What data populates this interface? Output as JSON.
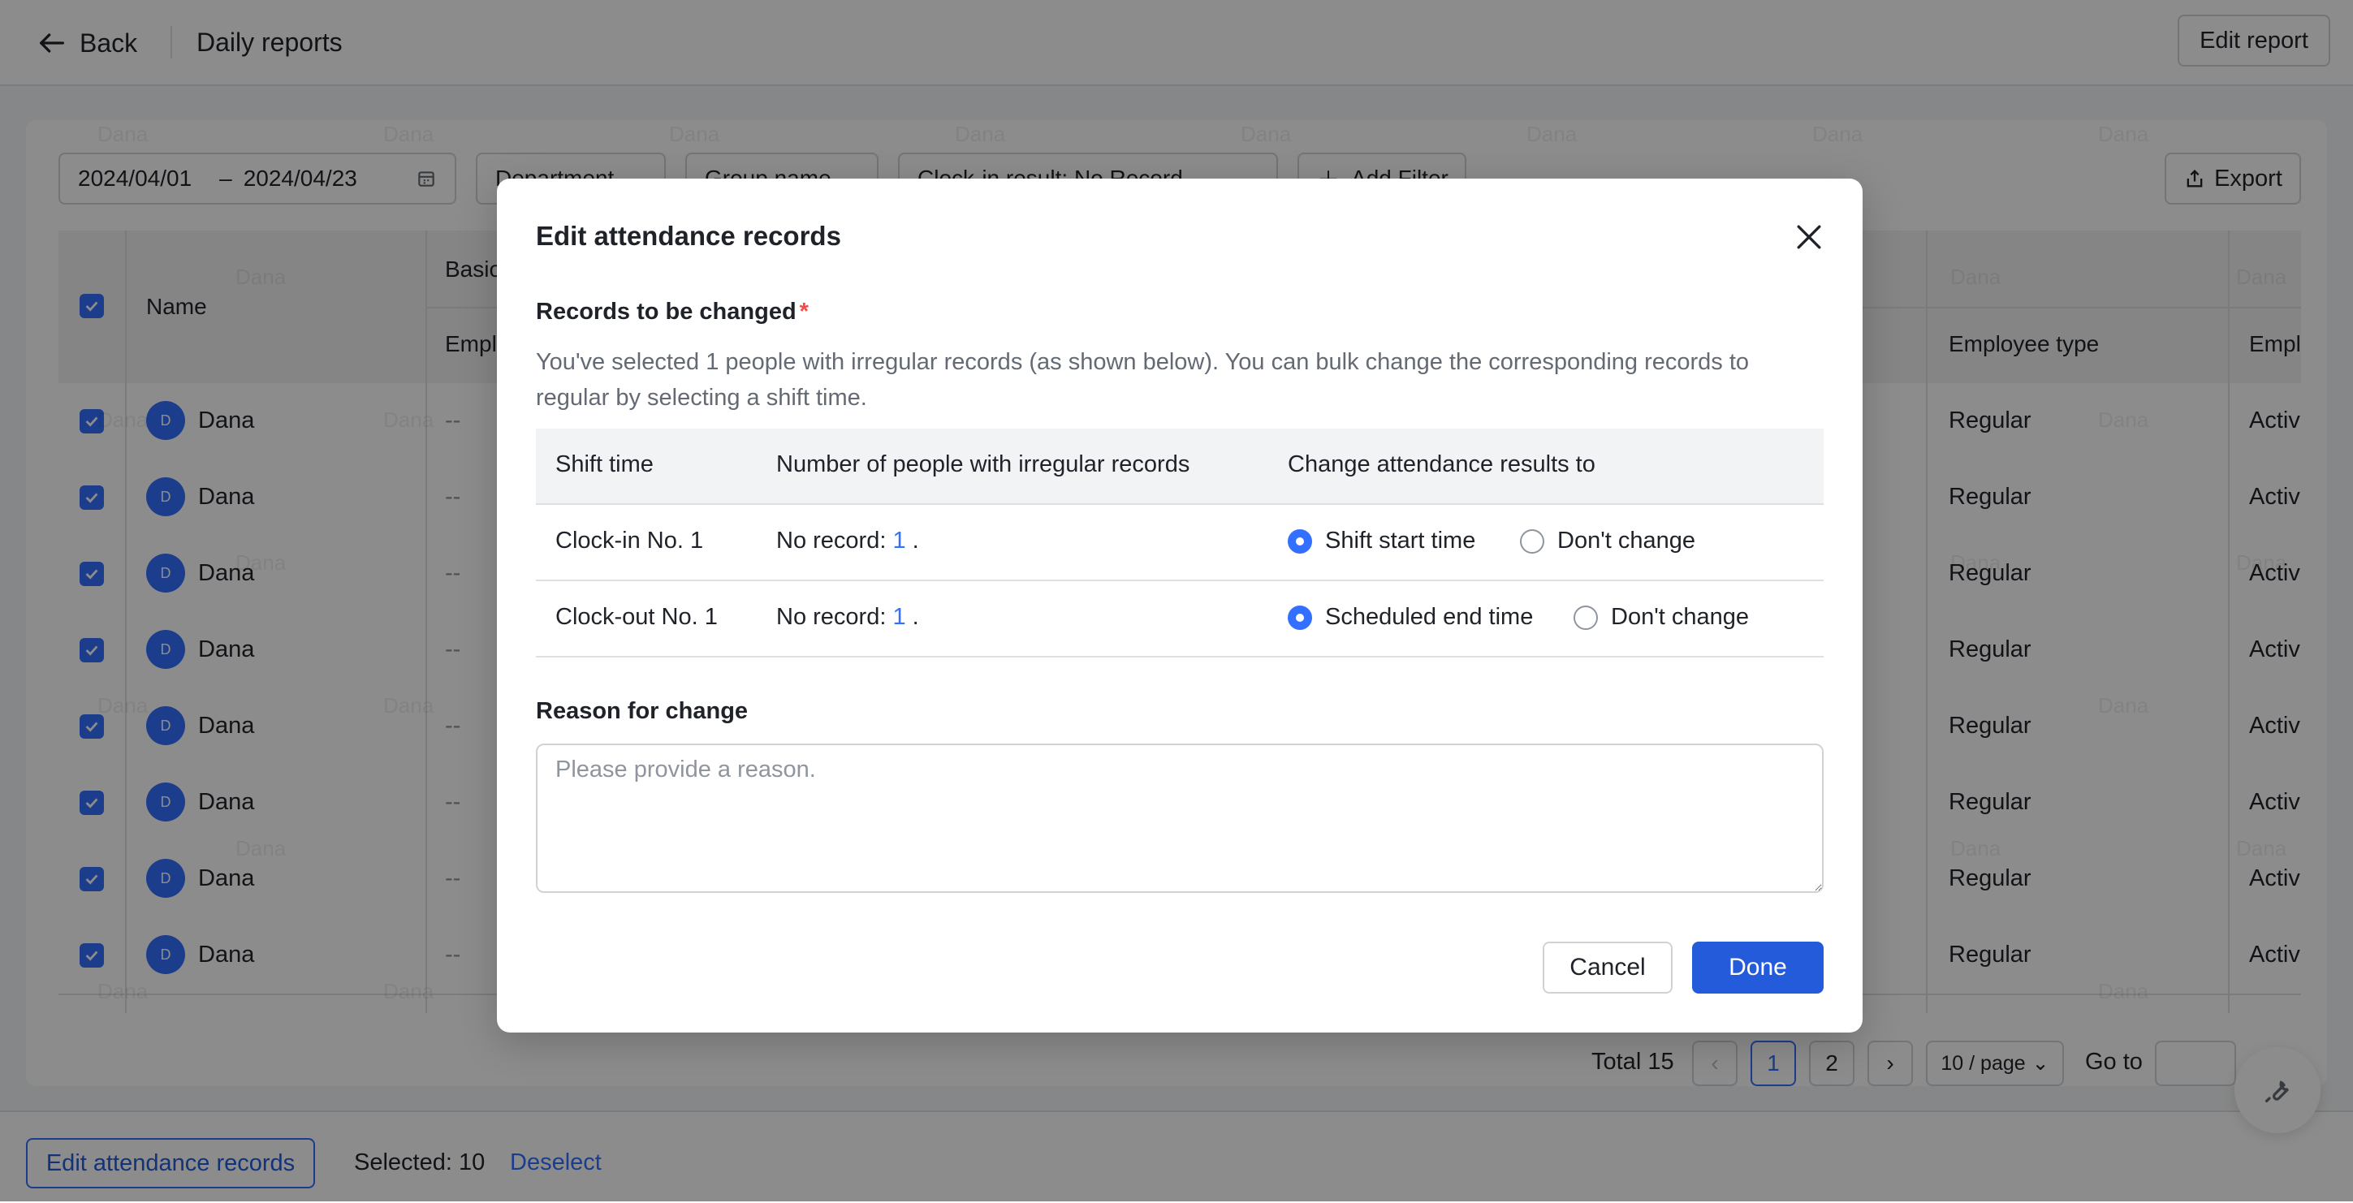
{
  "header": {
    "back_label": "Back",
    "page_title": "Daily reports",
    "edit_report_label": "Edit report"
  },
  "filters": {
    "date_start": "2024/04/01",
    "date_separator": "–",
    "date_end": "2024/04/23",
    "department": "Department",
    "group_name": "Group name",
    "clock_in_result": "Clock-in result: No Record",
    "add_filter": "Add Filter",
    "export": "Export"
  },
  "table": {
    "col_name": "Name",
    "group_basic": "Basic",
    "col_employee_no": "Empl",
    "col_employee_type": "Employee type",
    "col_employee_status": "Empl",
    "rows": [
      {
        "avatar": "D",
        "name": "Dana",
        "employee_no": "--",
        "type": "Regular",
        "status": "Activ"
      },
      {
        "avatar": "D",
        "name": "Dana",
        "employee_no": "--",
        "type": "Regular",
        "status": "Activ"
      },
      {
        "avatar": "D",
        "name": "Dana",
        "employee_no": "--",
        "type": "Regular",
        "status": "Activ"
      },
      {
        "avatar": "D",
        "name": "Dana",
        "employee_no": "--",
        "type": "Regular",
        "status": "Activ"
      },
      {
        "avatar": "D",
        "name": "Dana",
        "employee_no": "--",
        "type": "Regular",
        "status": "Activ"
      },
      {
        "avatar": "D",
        "name": "Dana",
        "employee_no": "--",
        "type": "Regular",
        "status": "Activ"
      },
      {
        "avatar": "D",
        "name": "Dana",
        "employee_no": "--",
        "type": "Regular",
        "status": "Activ"
      },
      {
        "avatar": "D",
        "name": "Dana",
        "employee_no": "--",
        "type": "Regular",
        "status": "Activ"
      }
    ]
  },
  "pagination": {
    "total": "Total 15",
    "page1": "1",
    "page2": "2",
    "page_size": "10 / page",
    "goto_label": "Go to"
  },
  "bottom_bar": {
    "edit_records": "Edit attendance records",
    "selected": "Selected: 10",
    "deselect": "Deselect"
  },
  "watermark": "Dana",
  "modal": {
    "title": "Edit attendance records",
    "records_label": "Records to be changed",
    "required_mark": "*",
    "description": "You've selected 1 people with irregular records (as shown below). You can bulk change the corresponding records to regular by selecting a shift time.",
    "col_shift": "Shift time",
    "col_count": "Number of people with irregular records",
    "col_change": "Change attendance results to",
    "rows": [
      {
        "shift": "Clock-in No. 1",
        "count_prefix": "No record: ",
        "count": "1",
        "count_suffix": " .",
        "option_a": "Shift start time",
        "option_b": "Don't change",
        "selected": "a"
      },
      {
        "shift": "Clock-out No. 1",
        "count_prefix": "No record: ",
        "count": "1",
        "count_suffix": " .",
        "option_a": "Scheduled end time",
        "option_b": "Don't change",
        "selected": "a"
      }
    ],
    "reason_label": "Reason for change",
    "reason_placeholder": "Please provide a reason.",
    "reason_value": "",
    "cancel": "Cancel",
    "done": "Done"
  },
  "colors": {
    "accent": "#3370ff",
    "done_button": "#245bdb",
    "required": "#f54a45"
  }
}
